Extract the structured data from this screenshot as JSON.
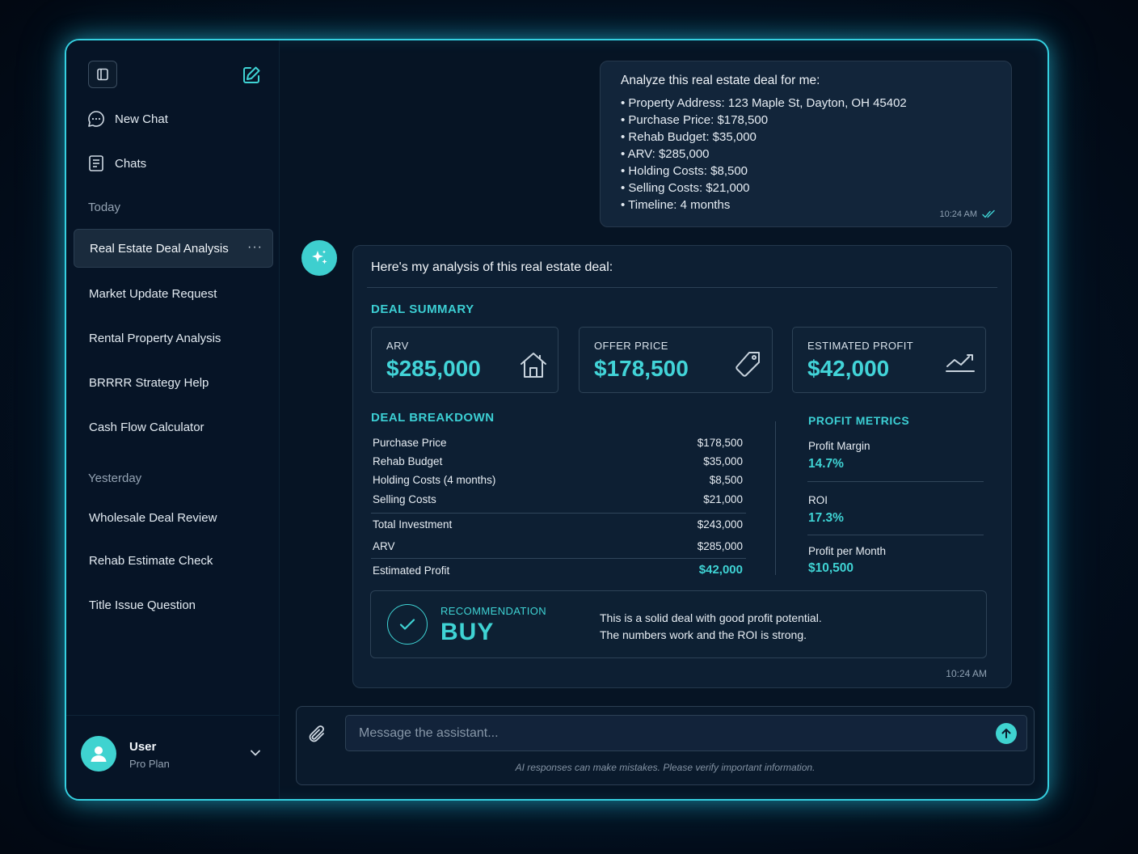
{
  "sidebar": {
    "new_chat": "New Chat",
    "chats": "Chats",
    "today_label": "Today",
    "today_items": [
      "Real Estate Deal Analysis",
      "Market Update Request",
      "Rental Property Analysis",
      "BRRRR Strategy Help",
      "Cash Flow Calculator"
    ],
    "active_more": "···",
    "yesterday_label": "Yesterday",
    "yesterday_items": [
      "Wholesale Deal Review",
      "Rehab Estimate Check",
      "Title Issue Question"
    ],
    "user": {
      "name": "User",
      "plan": "Pro Plan"
    }
  },
  "user_message": {
    "intro": "Analyze this real estate deal for me:",
    "items": [
      "Property Address: 123 Maple St, Dayton, OH 45402",
      "Purchase Price: $178,500",
      "Rehab Budget: $35,000",
      "ARV: $285,000",
      "Holding Costs: $8,500",
      "Selling Costs: $21,000",
      "Timeline: 4 months"
    ],
    "time": "10:24 AM"
  },
  "assistant_message": {
    "intro": "Here's my analysis of this real estate deal:",
    "summary_title": "DEAL SUMMARY",
    "cards": [
      {
        "label": "ARV",
        "value": "$285,000",
        "icon": "home-icon"
      },
      {
        "label": "OFFER PRICE",
        "value": "$178,500",
        "icon": "price-tag-icon"
      },
      {
        "label": "ESTIMATED PROFIT",
        "value": "$42,000",
        "icon": "trend-chart-icon"
      }
    ],
    "breakdown_title": "DEAL BREAKDOWN",
    "breakdown": [
      {
        "label": "Purchase Price",
        "value": "$178,500"
      },
      {
        "label": "Rehab Budget",
        "value": "$35,000"
      },
      {
        "label": "Holding Costs (4 months)",
        "value": "$8,500"
      },
      {
        "label": "Selling Costs",
        "value": "$21,000"
      },
      {
        "label": "Total Investment",
        "value": "$243,000"
      },
      {
        "label": "ARV",
        "value": "$285,000"
      },
      {
        "label": "Estimated Profit",
        "value": "$42,000"
      }
    ],
    "metrics_title": "PROFIT METRICS",
    "metrics": [
      {
        "label": "Profit Margin",
        "value": "14.7%"
      },
      {
        "label": "ROI",
        "value": "17.3%"
      },
      {
        "label": "Profit per Month",
        "value": "$10,500"
      }
    ],
    "recommendation": {
      "label": "RECOMMENDATION",
      "value": "BUY",
      "line1": "This is a solid deal with good profit potential.",
      "line2": "The numbers work and the ROI is strong."
    },
    "time": "10:24 AM"
  },
  "composer": {
    "placeholder": "Message the assistant...",
    "disclaimer": "AI responses can make mistakes. Please verify important information."
  },
  "colors": {
    "accent": "#3fd3d4",
    "frame_glow": "#35d0e0",
    "background": "#061424"
  }
}
